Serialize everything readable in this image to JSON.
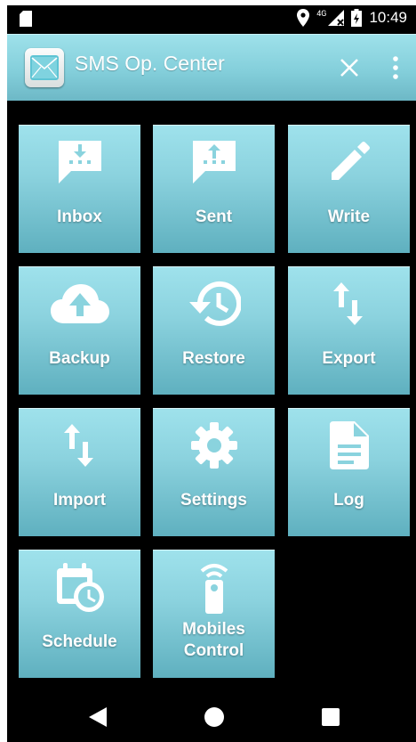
{
  "status_bar": {
    "time": "10:49",
    "network": "4G",
    "icons": [
      "sim-card-icon",
      "location-icon",
      "signal-icon",
      "battery-icon"
    ]
  },
  "app_bar": {
    "title": "SMS Op. Center",
    "app_icon": "envelope-icon",
    "actions": [
      "close-icon",
      "more-vert-icon"
    ]
  },
  "tiles": [
    {
      "label": "Inbox",
      "icon": "inbox-icon"
    },
    {
      "label": "Sent",
      "icon": "sent-icon"
    },
    {
      "label": "Write",
      "icon": "pencil-icon"
    },
    {
      "label": "Backup",
      "icon": "cloud-upload-icon"
    },
    {
      "label": "Restore",
      "icon": "restore-history-icon"
    },
    {
      "label": "Export",
      "icon": "export-arrows-icon"
    },
    {
      "label": "Import",
      "icon": "import-arrows-icon"
    },
    {
      "label": "Settings",
      "icon": "gear-icon"
    },
    {
      "label": "Log",
      "icon": "document-icon"
    },
    {
      "label": "Schedule",
      "icon": "calendar-clock-icon"
    },
    {
      "label": "Mobiles Control",
      "label_line1": "Mobiles",
      "label_line2": "Control",
      "icon": "remote-control-icon"
    }
  ],
  "nav_bar": {
    "buttons": [
      "back-icon",
      "home-icon",
      "recent-apps-icon"
    ]
  },
  "colors": {
    "accent": "#8ad3de",
    "tile_top": "#9fe2ec",
    "tile_bottom": "#5fb0bf",
    "background": "#000000"
  }
}
